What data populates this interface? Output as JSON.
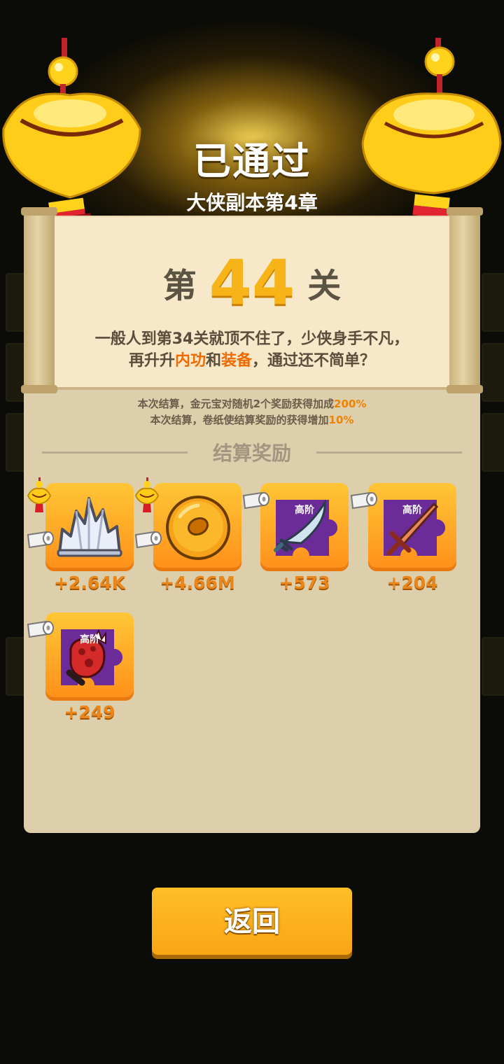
{
  "header": {
    "title": "已通过",
    "subtitle": "大侠副本第4章"
  },
  "level": {
    "prefix": "第",
    "number": "44",
    "suffix": "关"
  },
  "message": {
    "line1": "一般人到第34关就顶不住了，少侠身手不凡，",
    "line2_pre": "再升升",
    "line2_hl1": "内功",
    "line2_mid": "和",
    "line2_hl2": "装备",
    "line2_post": "，通过还不简单？"
  },
  "bonus": {
    "line1_text": "本次结算，金元宝对随机2个奖励获得加成",
    "line1_pct": "200%",
    "line2_text": "本次结算，卷纸使结算奖励的获得增加",
    "line2_pct": "10%"
  },
  "rewards_title": "结算奖励",
  "rewards": [
    {
      "icon": "crystal-icon",
      "amount": "+2.64K"
    },
    {
      "icon": "gold-ring-icon",
      "amount": "+4.66M"
    },
    {
      "icon": "saber-fragment-icon",
      "tier": "高阶",
      "amount": "+573"
    },
    {
      "icon": "sword-fragment-icon",
      "tier": "高阶",
      "amount": "+204"
    },
    {
      "icon": "glove-fragment-icon",
      "tier": "高阶",
      "amount": "+249"
    }
  ],
  "back_button": "返回",
  "colors": {
    "accent_orange": "#ef6a00",
    "level_gold": "#f7b418",
    "panel": "#ddcfac",
    "scroll": "#f6e8c8",
    "card_top": "#ffc636",
    "card_bottom": "#ff8f1a",
    "fragment_purple": "#6b2c9a"
  }
}
